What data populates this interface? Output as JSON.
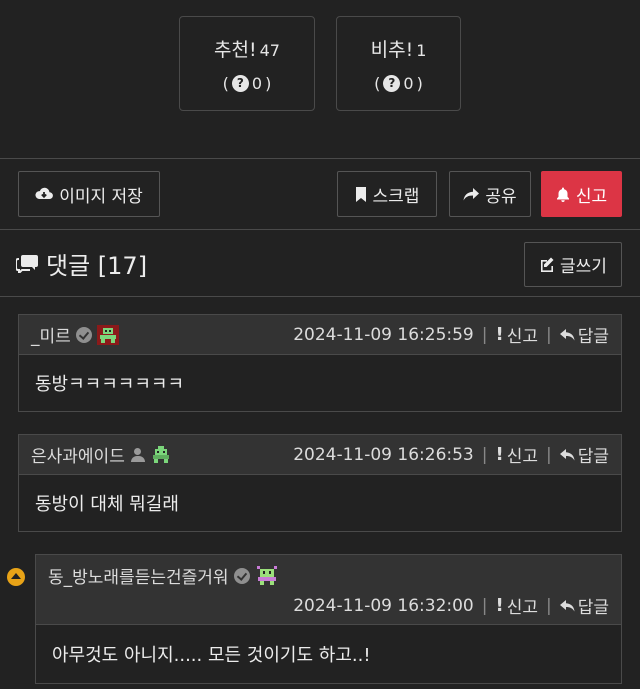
{
  "votes": {
    "up": {
      "label": "추천!",
      "count": "47",
      "sub": "0"
    },
    "down": {
      "label": "비추!",
      "count": "1",
      "sub": "0"
    }
  },
  "actions": {
    "save_image": "이미지 저장",
    "scrap": "스크랩",
    "share": "공유",
    "report": "신고",
    "report_color": "#dc3545"
  },
  "comments_section": {
    "title": "댓글 [17]",
    "write": "글쓰기"
  },
  "comment_actions": {
    "report": "신고",
    "reply": "답글"
  },
  "comments": [
    {
      "author": "_미르",
      "time": "2024-11-09 16:25:59",
      "text": "동방ㅋㅋㅋㅋㅋㅋㅋ"
    },
    {
      "author": "은사과에이드",
      "time": "2024-11-09 16:26:53",
      "text": "동방이 대체 뭐길래"
    },
    {
      "author": "동_방노래를듣는건즐거워",
      "time": "2024-11-09 16:32:00",
      "text": "아무것도 아니지..... 모든 것이기도 하고..!"
    }
  ]
}
